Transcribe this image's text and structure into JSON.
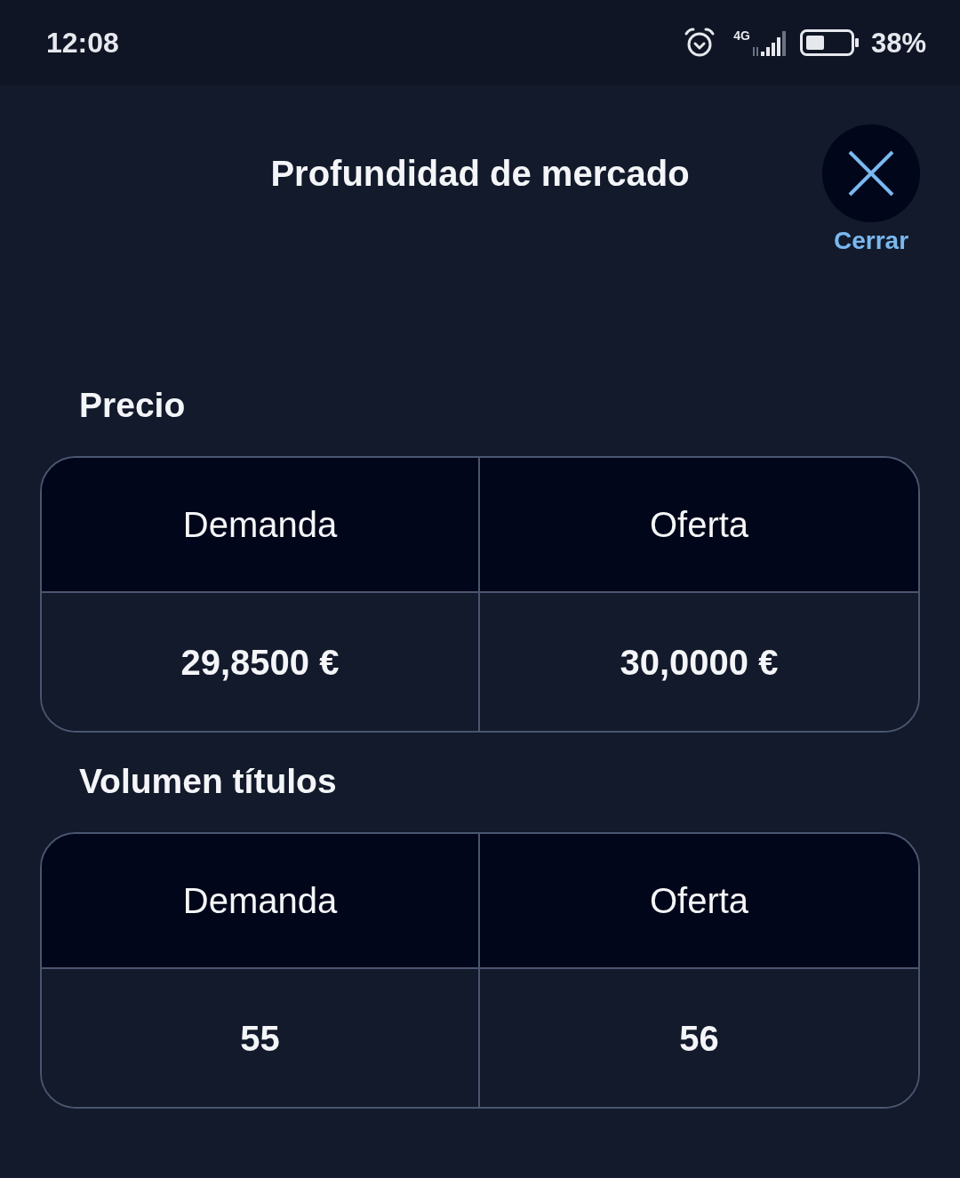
{
  "status_bar": {
    "time": "12:08",
    "network": "4G",
    "battery": "38%"
  },
  "header": {
    "title": "Profundidad de mercado",
    "close_label": "Cerrar"
  },
  "sections": [
    {
      "title": "Precio",
      "columns": [
        "Demanda",
        "Oferta"
      ],
      "values": [
        "29,8500 €",
        "30,0000 €"
      ]
    },
    {
      "title": "Volumen títulos",
      "columns": [
        "Demanda",
        "Oferta"
      ],
      "values": [
        "55",
        "56"
      ]
    }
  ]
}
